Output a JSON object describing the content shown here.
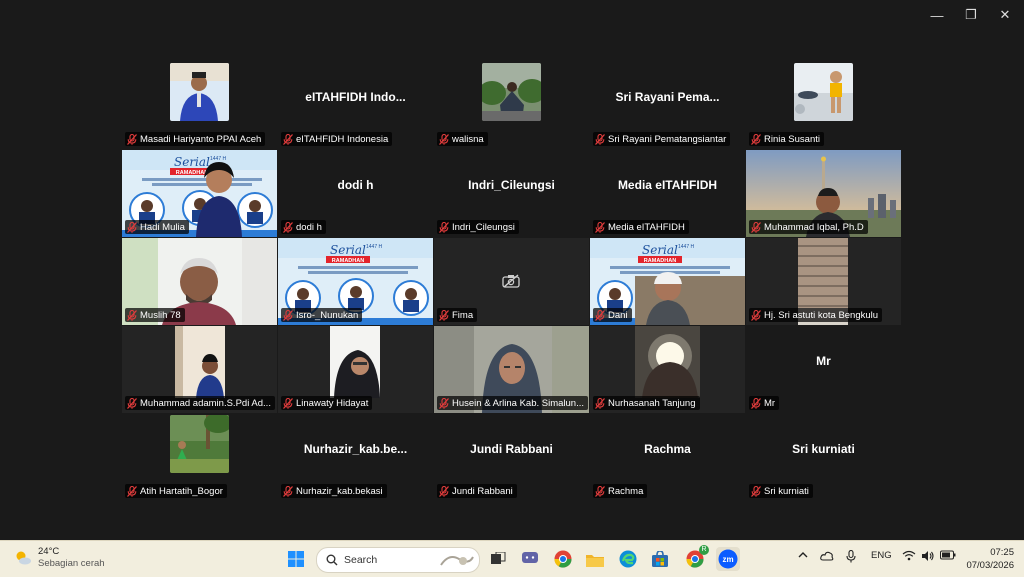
{
  "window": {
    "minimize": "—",
    "restore": "❐",
    "close": "✕"
  },
  "participants": [
    {
      "label": "Masadi Hariyanto PPAI Aceh",
      "display": "",
      "kind": "thumb-person"
    },
    {
      "label": "eITAHFIDH Indonesia",
      "display": "eITAHFIDH  Indo...",
      "kind": "name"
    },
    {
      "label": "walisna",
      "display": "",
      "kind": "thumb-outdoor"
    },
    {
      "label": "Sri Rayani Pematangsiantar",
      "display": "Sri  Rayani  Pema...",
      "kind": "name"
    },
    {
      "label": "Rinia Susanti",
      "display": "",
      "kind": "thumb-kid"
    },
    {
      "label": "Hadi Mulia",
      "display": "",
      "kind": "video-poster-person"
    },
    {
      "label": "dodi h",
      "display": "dodi h",
      "kind": "name"
    },
    {
      "label": "Indri_Cileungsi",
      "display": "Indri_Cileungsi",
      "kind": "name"
    },
    {
      "label": "Media eITAHFIDH",
      "display": "Media eITAHFIDH",
      "kind": "name"
    },
    {
      "label": "Muhammad Iqbal, Ph.D",
      "display": "",
      "kind": "video-city",
      "active": true
    },
    {
      "label": "Muslih 78",
      "display": "",
      "kind": "video-man"
    },
    {
      "label": "Isro-_Nunukan",
      "display": "",
      "kind": "video-poster"
    },
    {
      "label": "Fima",
      "display": "",
      "kind": "camera-off"
    },
    {
      "label": "Dani",
      "display": "",
      "kind": "video-poster-boy"
    },
    {
      "label": "Hj. Sri astuti kota Bengkulu",
      "display": "",
      "kind": "video-roof"
    },
    {
      "label": "Muhammad adamin.S.Pdi Ad...",
      "display": "",
      "kind": "video-portrait"
    },
    {
      "label": "Linawaty Hidayat",
      "display": "",
      "kind": "video-hijab"
    },
    {
      "label": "Husein & Arlina Kab. Simalun...",
      "display": "",
      "kind": "video-woman"
    },
    {
      "label": "Nurhasanah Tanjung",
      "display": "",
      "kind": "video-light"
    },
    {
      "label": "Mr",
      "display": "Mr",
      "kind": "name"
    },
    {
      "label": "Atih Hartatih_Bogor",
      "display": "",
      "kind": "thumb-park"
    },
    {
      "label": "Nurhazir_kab.bekasi",
      "display": "Nurhazir_kab.be...",
      "kind": "name"
    },
    {
      "label": "Jundi Rabbani",
      "display": "Jundi Rabbani",
      "kind": "name"
    },
    {
      "label": "Rachma",
      "display": "Rachma",
      "kind": "name"
    },
    {
      "label": "Sri kurniati",
      "display": "Sri kurniati",
      "kind": "name"
    }
  ],
  "poster": {
    "title1": "Serial",
    "title2": "RAMADHAN",
    "year": "1447 H"
  },
  "taskbar": {
    "weather_temp": "24°C",
    "weather_desc": "Sebagian cerah",
    "search_placeholder": "Search",
    "language": "ENG",
    "time": "07:25",
    "date": "07/03/2026",
    "chrome_badge": "R"
  },
  "colors": {
    "active_speaker": "#3ecf5a",
    "muted_icon": "#e03c3c",
    "taskbar_bg": "#f2eede"
  }
}
